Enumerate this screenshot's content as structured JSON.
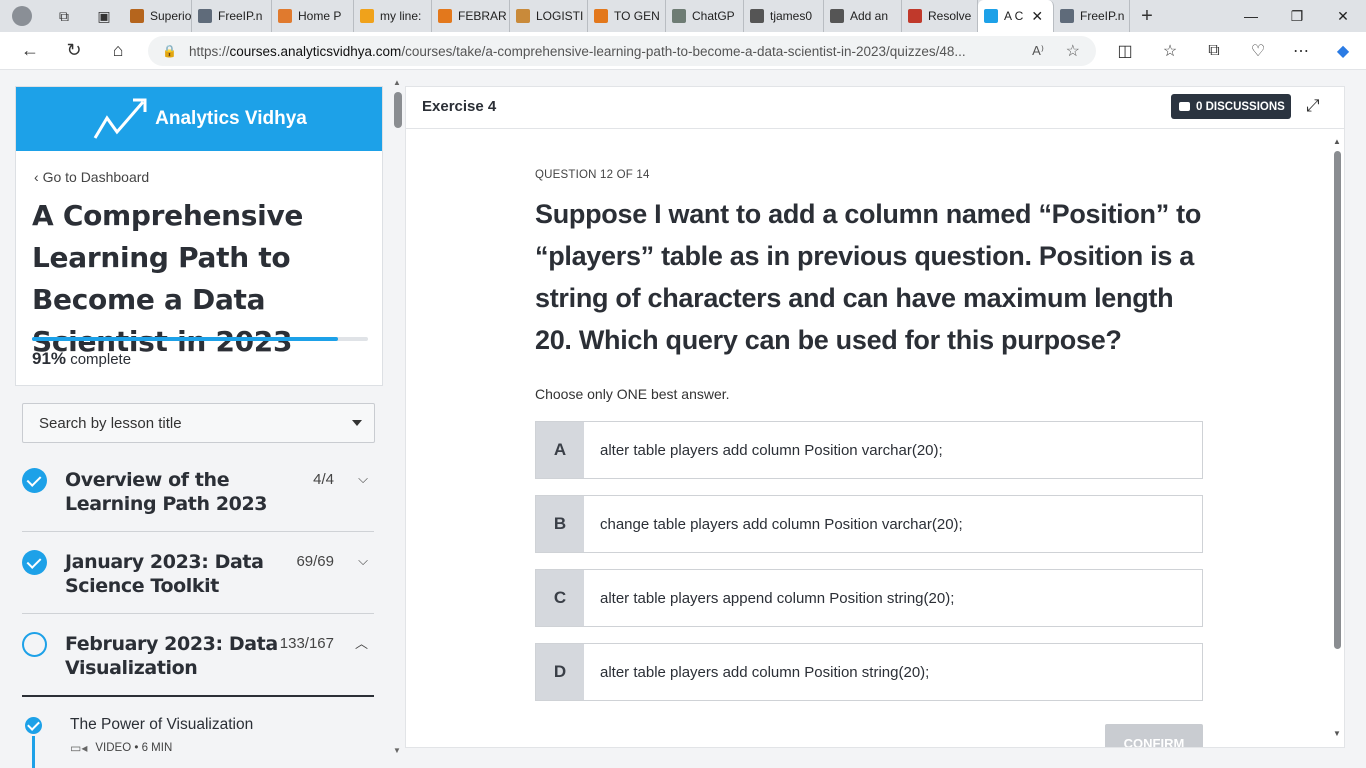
{
  "browser": {
    "tabs": [
      {
        "label": "Superio",
        "color": "#b5651d"
      },
      {
        "label": "FreeIP.n",
        "color": "#5f6b7a"
      },
      {
        "label": "Home P",
        "color": "#e07a2e"
      },
      {
        "label": "my line:",
        "color": "#f0a21b"
      },
      {
        "label": "FEBRAR",
        "color": "#e3781c"
      },
      {
        "label": "LOGISTI",
        "color": "#c98a3a"
      },
      {
        "label": "TO GEN",
        "color": "#e3781c"
      },
      {
        "label": "ChatGP",
        "color": "#6e7c74"
      },
      {
        "label": "tjames0",
        "color": "#555"
      },
      {
        "label": "Add an",
        "color": "#555"
      },
      {
        "label": "Resolve",
        "color": "#c0392b"
      },
      {
        "label": "A C",
        "color": "#1da1e8"
      },
      {
        "label": "FreeIP.n",
        "color": "#5f6b7a"
      }
    ],
    "active_tab_index": 11,
    "url_prefix": "https://",
    "url_host": "courses.analyticsvidhya.com",
    "url_path": "/courses/take/a-comprehensive-learning-path-to-become-a-data-scientist-in-2023/quizzes/48...",
    "icons": {
      "back": "back-arrow-icon",
      "refresh": "refresh-icon",
      "home": "home-icon",
      "lock": "lock-icon",
      "read_aloud": "read-aloud-icon",
      "favorite": "star-icon"
    }
  },
  "sidebar": {
    "brand": "Analytics Vidhya",
    "back_link": "Go to Dashboard",
    "course_title": "A Comprehensive Learning Path to Become a Data Scientist in 2023",
    "progress_value": 91,
    "progress_pct": "91%",
    "progress_label": "complete",
    "search_placeholder": "Search by lesson title",
    "sections": [
      {
        "title": "Overview of the Learning Path 2023",
        "count": "4/4",
        "done": true,
        "expanded": false
      },
      {
        "title": "January 2023: Data Science Toolkit",
        "count": "69/69",
        "done": true,
        "expanded": false
      },
      {
        "title": "February 2023: Data Visualization",
        "count": "133/167",
        "done": false,
        "expanded": true
      }
    ],
    "lesson": {
      "title": "The Power of Visualization",
      "meta": "VIDEO • 6 MIN"
    }
  },
  "main": {
    "header": "Exercise 4",
    "discussions": "0 DISCUSSIONS",
    "question_number": "QUESTION 12 OF 14",
    "question": "Suppose I want to add a column named “Position” to “players” table as in previous question. Position is a string of characters and can have maximum length 20. Which query can be used for this purpose?",
    "instruction": "Choose only ONE best answer.",
    "options": [
      {
        "letter": "A",
        "text": "alter table players add column Position varchar(20);"
      },
      {
        "letter": "B",
        "text": "change table players add column Position varchar(20);"
      },
      {
        "letter": "C",
        "text": "alter table players append column Position string(20);"
      },
      {
        "letter": "D",
        "text": "alter table players add column Position string(20);"
      }
    ],
    "confirm_label": "CONFIRM"
  },
  "colors": {
    "accent": "#1da1e8",
    "dark": "#2b3440"
  }
}
